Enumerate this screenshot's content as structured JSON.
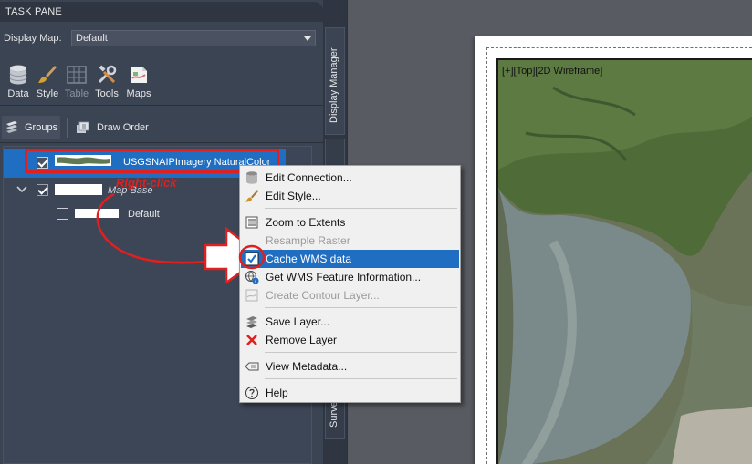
{
  "task_pane": {
    "title": "TASK PANE",
    "display_map_label": "Display Map:",
    "display_map_value": "Default",
    "toolbar": [
      {
        "label": "Data",
        "icon": "database-icon",
        "enabled": true
      },
      {
        "label": "Style",
        "icon": "brush-icon",
        "enabled": true
      },
      {
        "label": "Table",
        "icon": "table-icon",
        "enabled": false
      },
      {
        "label": "Tools",
        "icon": "tools-icon",
        "enabled": true
      },
      {
        "label": "Maps",
        "icon": "maps-icon",
        "enabled": true
      }
    ],
    "groups_label": "Groups",
    "draw_order_label": "Draw Order",
    "layers": {
      "selected_layer_name": "USGSNAIPImagery NaturalColor",
      "group_name": "Map Base",
      "default_layer_name": "Default"
    }
  },
  "side_tabs": {
    "display_manager": "Display Manager",
    "survey": "Survey"
  },
  "viewport": {
    "view_label": "[+][Top][2D Wireframe]"
  },
  "context_menu": {
    "items": [
      {
        "label": "Edit Connection...",
        "icon": "database-icon"
      },
      {
        "label": "Edit Style...",
        "icon": "brush-icon"
      },
      {
        "label": "Zoom to Extents",
        "icon": "zoom-extents-icon"
      },
      {
        "label": "Resample Raster",
        "icon": "",
        "disabled": true
      },
      {
        "label": "Cache WMS data",
        "icon": "check-icon",
        "highlighted": true
      },
      {
        "label": "Get WMS Feature Information...",
        "icon": "globe-info-icon"
      },
      {
        "label": "Create Contour Layer...",
        "icon": "contour-icon",
        "disabled": true
      },
      {
        "label": "Save Layer...",
        "icon": "save-layer-icon"
      },
      {
        "label": "Remove Layer",
        "icon": "close-icon"
      },
      {
        "label": "View Metadata...",
        "icon": "metadata-icon"
      },
      {
        "label": "Help",
        "icon": "help-icon"
      }
    ]
  },
  "annotation": {
    "right_click_label": "Right-click"
  },
  "colors": {
    "accent": "#1f6ec2",
    "annotation_red": "#e02020",
    "pane_bg": "#3b4453"
  }
}
